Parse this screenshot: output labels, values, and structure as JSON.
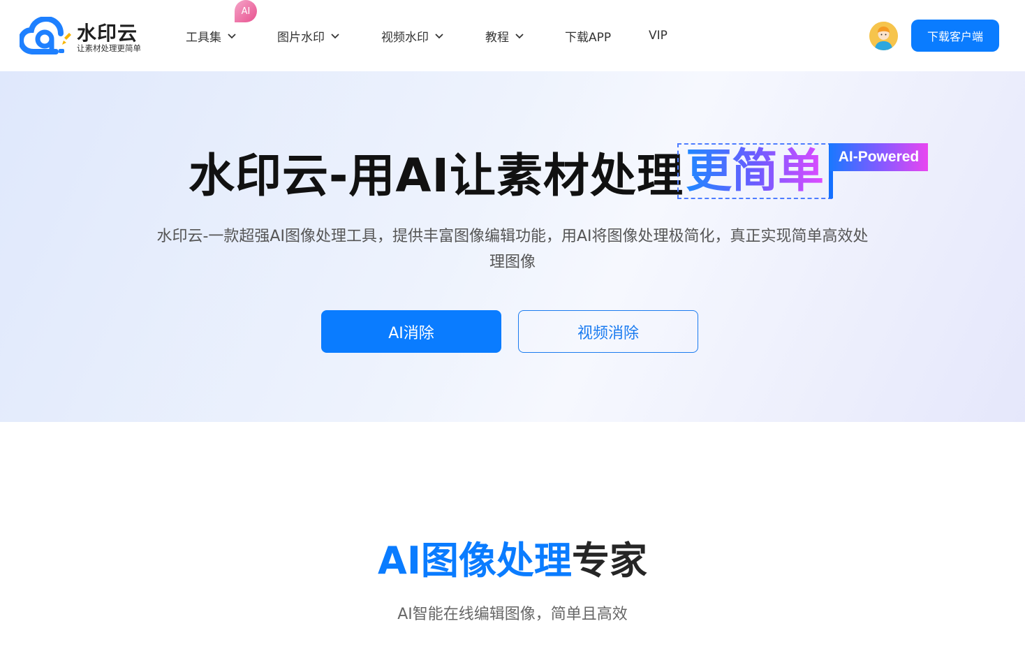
{
  "brand": {
    "name": "水印云",
    "slogan": "让素材处理更简单",
    "colors": {
      "primary": "#0a7cff",
      "logo_blue": "#1e80ff",
      "logo_yellow": "#f7b500"
    }
  },
  "nav": {
    "items": [
      {
        "label": "工具集",
        "has_dropdown": true,
        "badge": "AI"
      },
      {
        "label": "图片水印",
        "has_dropdown": true
      },
      {
        "label": "视频水印",
        "has_dropdown": true
      },
      {
        "label": "教程",
        "has_dropdown": true
      },
      {
        "label": "下载APP",
        "has_dropdown": false
      },
      {
        "label": "VIP",
        "has_dropdown": false
      }
    ],
    "download_client": "下载客户端",
    "avatar_icon": "user-avatar-icon"
  },
  "hero": {
    "title_main": "水印云-用AI让素材处理",
    "title_highlight": "更简单",
    "ai_tag": "AI-Powered",
    "description": "水印云-一款超强AI图像处理工具，提供丰富图像编辑功能，用AI将图像处理极简化，真正实现简单高效处理图像",
    "primary_button": "AI消除",
    "secondary_button": "视频消除",
    "gradient_colors": [
      "#1e88ff",
      "#6b5cff",
      "#e04bff"
    ]
  },
  "section": {
    "title_blue": "AI图像处理",
    "title_dark": "专家",
    "subtitle": "AI智能在线编辑图像，简单且高效"
  }
}
